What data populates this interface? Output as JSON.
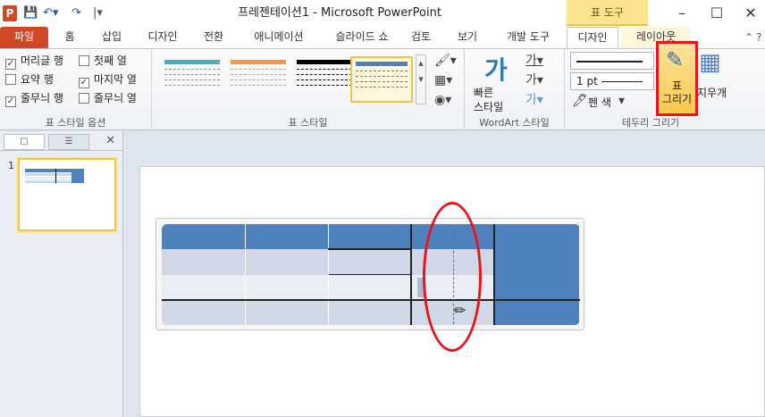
{
  "titlebar": {
    "app_icon": "P",
    "title": "프레젠테이션1 - Microsoft PowerPoint",
    "context_tab_header": "표 도구",
    "minimize_glyph": "–",
    "restore_glyph": "☐",
    "close_glyph": "✕"
  },
  "tabs": {
    "file": "파일",
    "home": "홈",
    "insert": "삽입",
    "design_main": "디자인",
    "transitions": "전환",
    "animations": "애니메이션",
    "slideshow": "슬라이드 쇼",
    "review": "검토",
    "view": "보기",
    "developer": "개발 도구",
    "design": "디자인",
    "layout": "레이아웃"
  },
  "ribbon": {
    "table_style_options": {
      "label": "표 스타일 옵션",
      "header_row": "머리글 행",
      "first_column": "첫째 열",
      "total_row": "요약 행",
      "last_column": "마지막 열",
      "banded_rows": "줄무늬 행",
      "banded_columns": "줄무늬 열"
    },
    "table_styles": {
      "label": "표 스타일"
    },
    "wordart": {
      "label": "WordArt 스타일",
      "quick_styles": "빠른",
      "quick_styles_2": "스타일",
      "glyph": "가"
    },
    "borders": {
      "label": "테두리 그리기",
      "pen_weight": "1 pt",
      "pen_color": "펜 색",
      "draw_table": "표",
      "draw_table_2": "그리기",
      "eraser": "지우개"
    }
  },
  "panel": {
    "slide_number": "1"
  }
}
